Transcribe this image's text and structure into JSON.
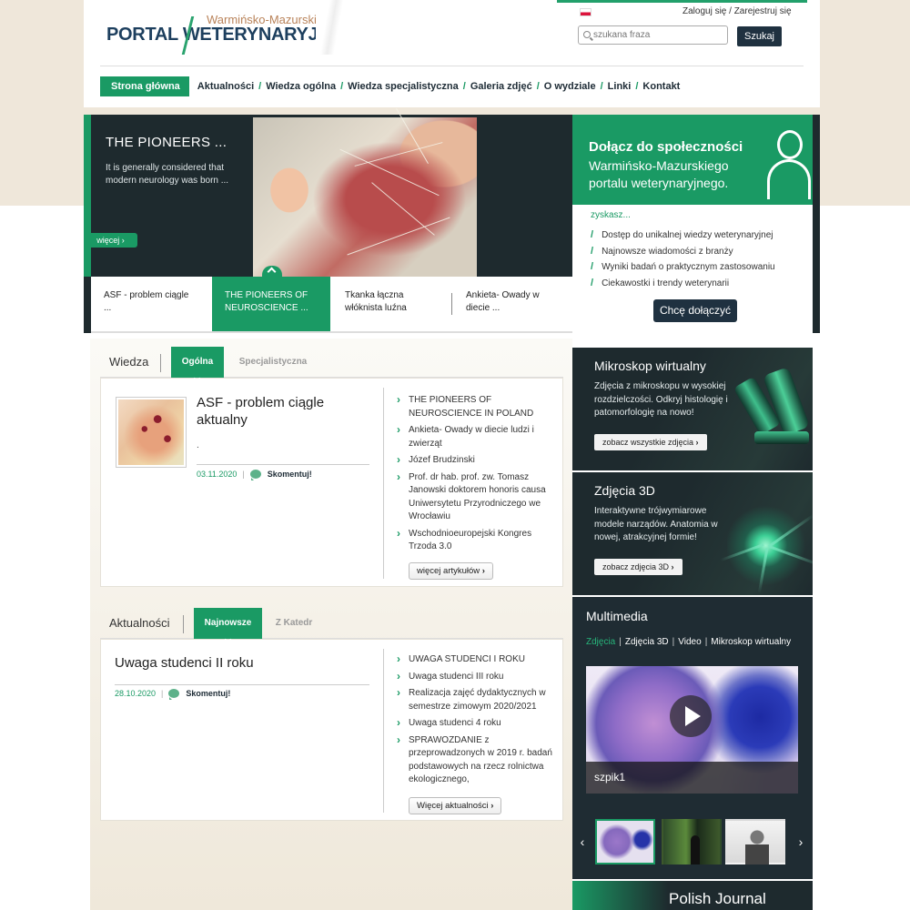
{
  "header": {
    "logo_sub": "Warmińsko-Mazurski",
    "logo_main": "PORTAL WETERYNARYJNY",
    "login": "Zaloguj się",
    "login_sep": "/",
    "register": "Zarejestruj się",
    "search_placeholder": "szukana fraza",
    "search_button": "Szukaj"
  },
  "nav": {
    "items": [
      "Strona główna",
      "Aktualności",
      "Wiedza ogólna",
      "Wiedza specjalistyczna",
      "Galeria zdjęć",
      "O wydziale",
      "Linki",
      "Kontakt"
    ],
    "separator": "/"
  },
  "slider": {
    "title": "THE PIONEERS ...",
    "text": "It is generally considered that modern neurology was born ...",
    "more": "więcej ›",
    "tabs": [
      "ASF - problem ciągle ...",
      "THE PIONEERS OF NEUROSCIENCE ...",
      "Tkanka łączna włóknista luźna",
      "Ankieta- Owady w diecie ..."
    ]
  },
  "join": {
    "line1": "Dołącz do społeczności",
    "line2": "Warmińsko-Mazurskiego portalu weterynaryjnego.",
    "gain": "zyskasz...",
    "benefits": [
      "Dostęp do unikalnej wiedzy weterynaryjnej",
      "Najnowsze wiadomości z branży",
      "Wyniki badań o praktycznym zastosowaniu",
      "Ciekawostki i trendy weterynarii"
    ],
    "button": "Chcę dołączyć"
  },
  "wiedza": {
    "title": "Wiedza",
    "tabs": [
      "Ogólna",
      "Specjalistyczna"
    ],
    "featured_title": "ASF - problem ciągle aktualny",
    "featured_excerpt": ".",
    "date": "03.11.2020",
    "meta_sep": "|",
    "comment": "Skomentuj!",
    "articles": [
      "THE PIONEERS OF NEUROSCIENCE IN POLAND",
      "Ankieta- Owady w diecie ludzi i zwierząt",
      "Józef Brudzinski",
      "Prof. dr hab. prof. zw. Tomasz Janowski doktorem honoris causa Uniwersytetu Przyrodniczego we Wrocławiu",
      "Wschodnioeuropejski Kongres Trzoda 3.0"
    ],
    "more": "więcej artykułów"
  },
  "aktualnosci": {
    "title": "Aktualności",
    "tabs": [
      "Najnowsze",
      "Z Katedr"
    ],
    "featured_title": "Uwaga studenci II roku",
    "date": "28.10.2020",
    "meta_sep": "|",
    "comment": "Skomentuj!",
    "articles": [
      "UWAGA STUDENCI I ROKU",
      "Uwaga studenci III roku",
      "Realizacja zajęć dydaktycznych w semestrze zimowym 2020/2021",
      "Uwaga studenci 4 roku",
      "SPRAWOZDANIE z przeprowadzonych w 2019 r. badań podstawowych na rzecz rolnictwa ekologicznego,"
    ],
    "more": "Więcej aktualności"
  },
  "mikroskop": {
    "title": "Mikroskop wirtualny",
    "text": "Zdjęcia z mikroskopu w wysokiej rozdzielczości. Odkryj histologię i patomorfologię na nowo!",
    "button": "zobacz wszystkie zdjęcia"
  },
  "zdjecia3d": {
    "title": "Zdjęcia 3D",
    "text": "Interaktywne trójwymiarowe modele narządów. Anatomia w nowej, atrakcyjnej formie!",
    "button": "zobacz zdjęcia 3D"
  },
  "multimedia": {
    "title": "Multimedia",
    "tabs": [
      "Zdjęcia",
      "Zdjęcia 3D",
      "Video",
      "Mikroskop wirtualny"
    ],
    "tab_sep": "|",
    "active_tab": "Zdjęcia",
    "video_caption": "szpik1",
    "prev": "‹",
    "next": "›"
  },
  "polish_journal": {
    "title": "Polish Journal"
  },
  "colors": {
    "accent": "#1a9a64",
    "dark": "#1e2a2e",
    "navy": "#1f3140",
    "beige": "#efe7da"
  }
}
